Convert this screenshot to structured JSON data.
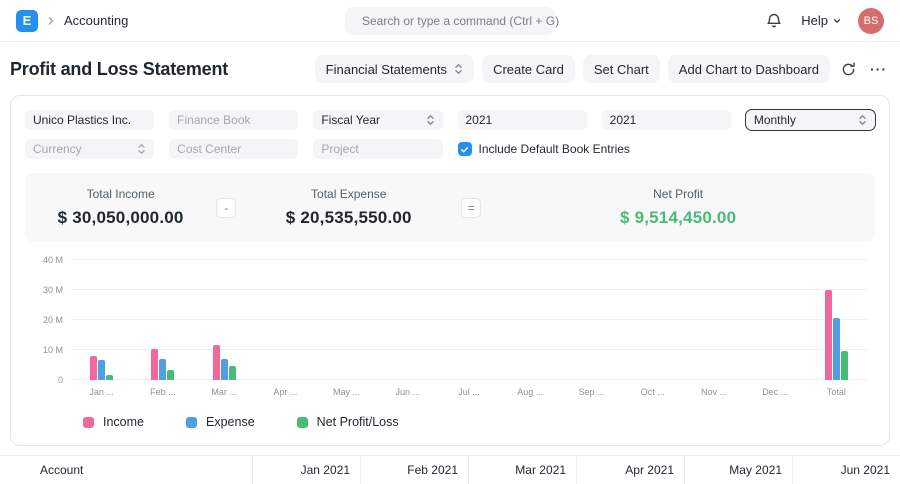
{
  "navbar": {
    "logo_letter": "E",
    "breadcrumb": "Accounting",
    "search_placeholder": "Search or type a command (Ctrl + G)",
    "help_label": "Help",
    "avatar_initials": "BS"
  },
  "icons": {
    "ellipsis": "···"
  },
  "header": {
    "title": "Profit and Loss Statement",
    "actions": {
      "financial_statements": "Financial Statements",
      "create_card": "Create Card",
      "set_chart": "Set Chart",
      "add_chart": "Add Chart to Dashboard"
    }
  },
  "filters": {
    "company": "Unico Plastics Inc.",
    "finance_book_placeholder": "Finance Book",
    "period_basis": "Fiscal Year",
    "from_year": "2021",
    "to_year": "2021",
    "periodicity": "Monthly",
    "currency_placeholder": "Currency",
    "cost_center_placeholder": "Cost Center",
    "project_placeholder": "Project",
    "include_default_books": "Include Default Book Entries"
  },
  "summary": {
    "income_label": "Total Income",
    "income_value": "$ 30,050,000.00",
    "minus": "-",
    "expense_label": "Total Expense",
    "expense_value": "$ 20,535,550.00",
    "equals": "=",
    "net_label": "Net Profit",
    "net_value": "$ 9,514,450.00",
    "net_color": "#48BB78"
  },
  "chart_data": {
    "type": "bar",
    "title": "Profit and Loss (Monthly, FY 2021)",
    "categories": [
      "Jan ...",
      "Feb ...",
      "Mar ...",
      "Apr ...",
      "May ...",
      "Jun ...",
      "Jul ...",
      "Aug ...",
      "Sep ...",
      "Oct ...",
      "Nov ...",
      "Dec ...",
      "Total"
    ],
    "series": [
      {
        "name": "Income",
        "color": "#F2689C",
        "values": [
          8050000,
          10250000,
          11750000,
          0,
          0,
          0,
          0,
          0,
          0,
          0,
          0,
          0,
          30050000
        ]
      },
      {
        "name": "Expense",
        "color": "#509FE3",
        "values": [
          6535550,
          7000000,
          7000000,
          0,
          0,
          0,
          0,
          0,
          0,
          0,
          0,
          0,
          20535550
        ]
      },
      {
        "name": "Net Profit/Loss",
        "color": "#48BB78",
        "values": [
          1514450,
          3250000,
          4750000,
          0,
          0,
          0,
          0,
          0,
          0,
          0,
          0,
          0,
          9514450
        ]
      }
    ],
    "y_ticks": [
      "40 M",
      "30 M",
      "20 M",
      "10 M",
      "0"
    ],
    "ylim": [
      0,
      40000000
    ],
    "grid": true,
    "legend_position": "bottom-left"
  },
  "table": {
    "columns": [
      "Account",
      "Jan 2021",
      "Feb 2021",
      "Mar 2021",
      "Apr 2021",
      "May 2021",
      "Jun 2021"
    ]
  }
}
